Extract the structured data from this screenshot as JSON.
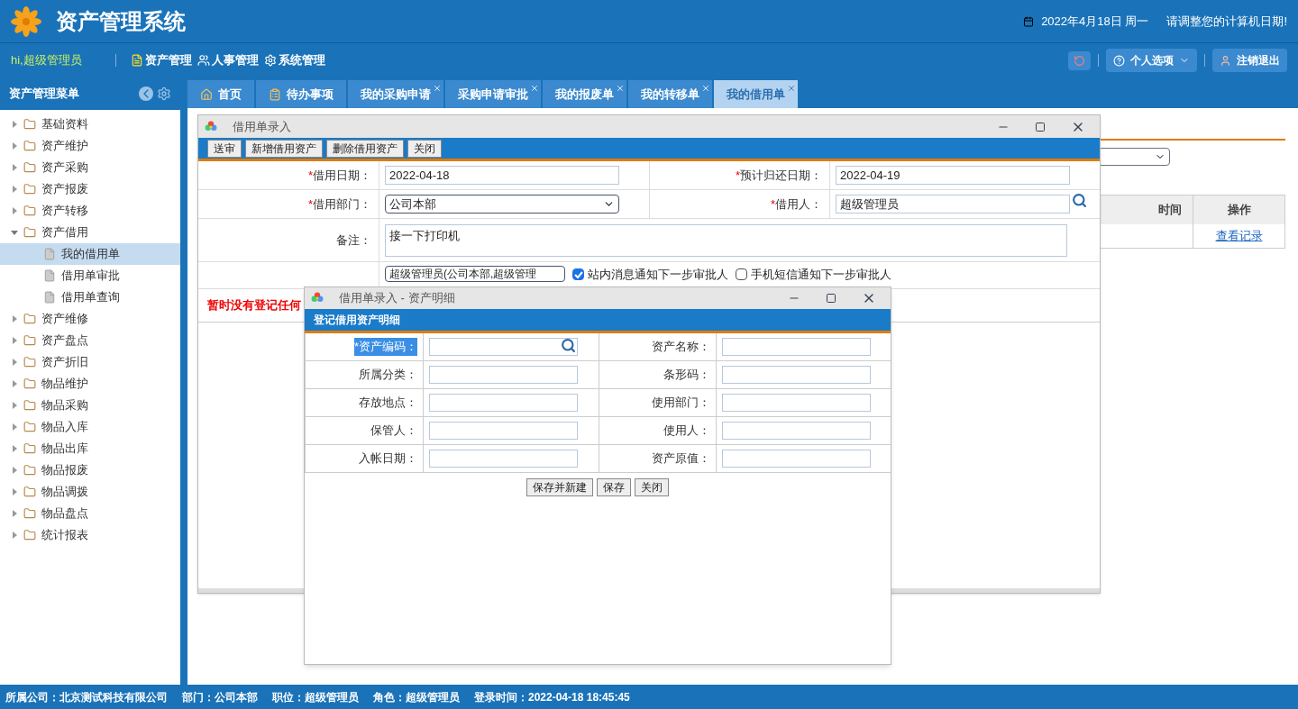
{
  "header": {
    "title": "资产管理系统",
    "date": "2022年4月18日 周一",
    "notice": "请调整您的计算机日期!"
  },
  "nav": {
    "greeting": "hi,超级管理员",
    "menus": [
      "资产管理",
      "人事管理",
      "系统管理"
    ],
    "options_button": "个人选项",
    "logout_button": "注销退出"
  },
  "sidebar": {
    "title": "资产管理菜单",
    "items": [
      {
        "label": "基础资料",
        "expanded": false,
        "selected": false
      },
      {
        "label": "资产维护",
        "expanded": false,
        "selected": false
      },
      {
        "label": "资产采购",
        "expanded": false,
        "selected": false
      },
      {
        "label": "资产报废",
        "expanded": false,
        "selected": false
      },
      {
        "label": "资产转移",
        "expanded": false,
        "selected": false
      },
      {
        "label": "资产借用",
        "expanded": true,
        "selected": false,
        "children": [
          {
            "label": "我的借用单",
            "selected": true
          },
          {
            "label": "借用单审批",
            "selected": false
          },
          {
            "label": "借用单查询",
            "selected": false
          }
        ]
      },
      {
        "label": "资产维修",
        "expanded": false,
        "selected": false
      },
      {
        "label": "资产盘点",
        "expanded": false,
        "selected": false
      },
      {
        "label": "资产折旧",
        "expanded": false,
        "selected": false
      },
      {
        "label": "物品维护",
        "expanded": false,
        "selected": false
      },
      {
        "label": "物品采购",
        "expanded": false,
        "selected": false
      },
      {
        "label": "物品入库",
        "expanded": false,
        "selected": false
      },
      {
        "label": "物品出库",
        "expanded": false,
        "selected": false
      },
      {
        "label": "物品报废",
        "expanded": false,
        "selected": false
      },
      {
        "label": "物品调拨",
        "expanded": false,
        "selected": false
      },
      {
        "label": "物品盘点",
        "expanded": false,
        "selected": false
      },
      {
        "label": "统计报表",
        "expanded": false,
        "selected": false
      }
    ]
  },
  "tabs": [
    {
      "label": "首页",
      "selected": false,
      "closable": false,
      "kind": "home"
    },
    {
      "label": "待办事项",
      "selected": false,
      "closable": false,
      "kind": "todo"
    },
    {
      "label": "我的采购申请",
      "selected": false,
      "closable": true,
      "kind": "plain"
    },
    {
      "label": "采购申请审批",
      "selected": false,
      "closable": true,
      "kind": "plain"
    },
    {
      "label": "我的报废单",
      "selected": false,
      "closable": true,
      "kind": "plain"
    },
    {
      "label": "我的转移单",
      "selected": false,
      "closable": true,
      "kind": "plain"
    },
    {
      "label": "我的借用单",
      "selected": true,
      "closable": true,
      "kind": "plain"
    }
  ],
  "background_page": {
    "columns": [
      "时间",
      "操作"
    ],
    "link": "查看记录"
  },
  "borrow_dialog": {
    "title": "借用单录入",
    "toolbar": [
      "送审",
      "新增借用资产",
      "删除借用资产",
      "关闭"
    ],
    "fields": [
      {
        "label": "借用日期：",
        "required_mark": "*",
        "value": "2022-04-18",
        "kind": "text"
      },
      {
        "label": "预计归还日期：",
        "required_mark": "*",
        "value": "2022-04-19",
        "kind": "text"
      },
      {
        "label": "借用部门：",
        "required_mark": "*",
        "value": "公司本部",
        "kind": "select"
      },
      {
        "label": "借用人：",
        "required_mark": "*",
        "value": "超级管理员",
        "kind": "lookup"
      }
    ],
    "remark": {
      "label": "备注：",
      "value": "接一下打印机"
    },
    "approver": "超级管理员(公司本部,超级管理",
    "notify": [
      {
        "label": "站内消息通知下一步审批人",
        "checked": true
      },
      {
        "label": "手机短信通知下一步审批人",
        "checked": false
      }
    ],
    "empty_message": "暂时没有登记任何"
  },
  "detail_dialog": {
    "title": "借用单录入 - 资产明细",
    "section_title": "登记借用资产明细",
    "fields": [
      {
        "label": "*资产编码：",
        "highlighted": true,
        "kind": "lookup"
      },
      {
        "label": "资产名称：",
        "highlighted": false,
        "kind": "text"
      },
      {
        "label": "所属分类：",
        "highlighted": false,
        "kind": "text"
      },
      {
        "label": "条形码：",
        "highlighted": false,
        "kind": "text"
      },
      {
        "label": "存放地点：",
        "highlighted": false,
        "kind": "text"
      },
      {
        "label": "使用部门：",
        "highlighted": false,
        "kind": "text"
      },
      {
        "label": "保管人：",
        "highlighted": false,
        "kind": "text"
      },
      {
        "label": "使用人：",
        "highlighted": false,
        "kind": "text"
      },
      {
        "label": "入帐日期：",
        "highlighted": false,
        "kind": "text"
      },
      {
        "label": "资产原值：",
        "highlighted": false,
        "kind": "text"
      }
    ],
    "buttons": [
      "保存并新建",
      "保存",
      "关闭"
    ]
  },
  "status_bar": [
    "所属公司：北京测试科技有限公司",
    "部门：公司本部",
    "职位：超级管理员",
    "角色：超级管理员",
    "登录时间：2022-04-18 18:45:45"
  ]
}
